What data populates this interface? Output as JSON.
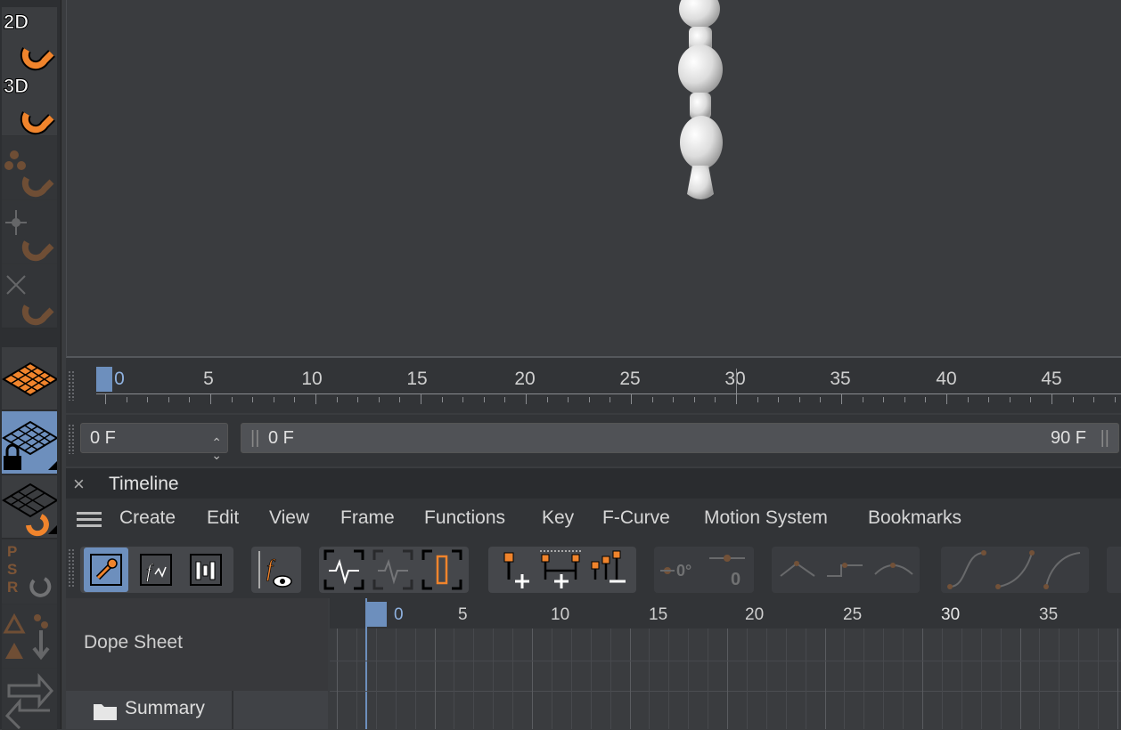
{
  "left_toolbar": {
    "tools": [
      {
        "label": "2D",
        "icon": "snap-2d-magnet-icon"
      },
      {
        "label": "3D",
        "icon": "snap-3d-magnet-icon"
      },
      {
        "label": "",
        "icon": "vertex-snap-magnet-icon"
      },
      {
        "label": "",
        "icon": "axis-snap-magnet-icon"
      },
      {
        "label": "",
        "icon": "intersection-snap-magnet-icon"
      },
      {
        "label": "",
        "icon": "workplane-icon"
      },
      {
        "label": "",
        "icon": "locked-workplane-icon"
      },
      {
        "label": "",
        "icon": "align-workplane-icon"
      },
      {
        "label": "",
        "icon": "psr-reset-icon"
      },
      {
        "label": "",
        "icon": "drop-to-floor-icon"
      },
      {
        "label": "",
        "icon": "transfer-icon"
      }
    ],
    "psr_letters": [
      "P",
      "S",
      "R"
    ]
  },
  "ruler": {
    "labels": [
      "0",
      "5",
      "10",
      "15",
      "20",
      "25",
      "30",
      "35",
      "40",
      "45"
    ]
  },
  "frame_range": {
    "current_frame": "0 F",
    "start": "0 F",
    "end": "90 F"
  },
  "timeline": {
    "tab_close": "×",
    "title": "Timeline",
    "menu": [
      "Create",
      "Edit",
      "View",
      "Frame",
      "Functions",
      "Key",
      "F-Curve",
      "Motion System",
      "Bookmarks"
    ],
    "toolbar_icons": [
      "key-mode-icon",
      "f-curve-mode-icon",
      "motion-mode-icon",
      "show-f-curve-icon",
      "linear-keys-icon",
      "ghost-keys-icon",
      "frame-selected-icon",
      "add-key-icon",
      "add-keys-all-icon",
      "delete-keys-icon",
      "zero-angle-icon",
      "zero-length-icon",
      "tangent-break-icon",
      "tangent-step-icon",
      "tangent-ease-icon",
      "ease-in-out-icon",
      "ease-in-icon",
      "ease-out-icon"
    ],
    "left_panel": {
      "heading": "Dope Sheet",
      "summary_label": "Summary"
    },
    "grid_labels": [
      "0",
      "5",
      "10",
      "15",
      "20",
      "25",
      "30",
      "35"
    ]
  },
  "colors": {
    "accent": "#6d8fbd",
    "orange": "#f0842c",
    "background": "#3a3c3f"
  }
}
